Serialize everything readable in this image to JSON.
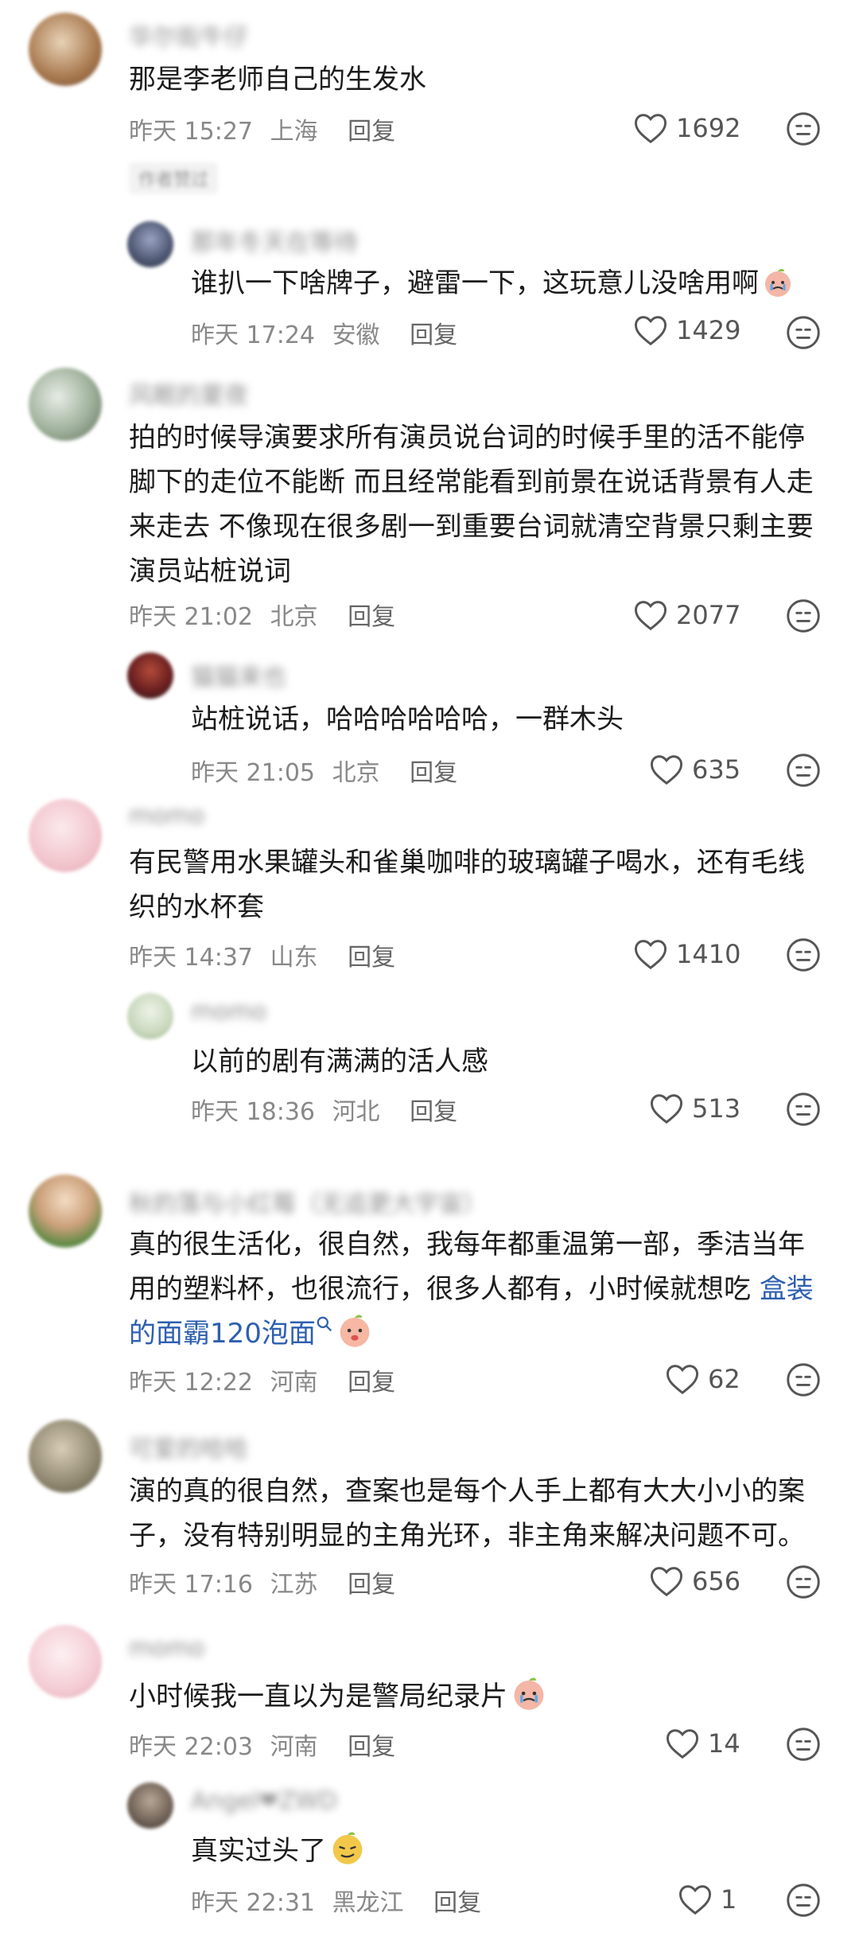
{
  "comments": [
    {
      "user": "华尔街牛仔",
      "text": "那是李老师自己的生发水",
      "date": "昨天",
      "time": "15:27",
      "location": "上海",
      "reply_label": "回复",
      "likes": "1692",
      "tag": "作者赞过"
    },
    {
      "user": "那年冬天在等待",
      "text": "谁扒一下啥牌子，避雷一下，这玩意儿没啥用啊",
      "date": "昨天",
      "time": "17:24",
      "location": "安徽",
      "reply_label": "回复",
      "likes": "1429"
    },
    {
      "user": "风眠的夏夜",
      "text": "拍的时候导演要求所有演员说台词的时候手里的活不能停脚下的走位不能断 而且经常能看到前景在说话背景有人走来走去 不像现在很多剧一到重要台词就清空背景只剩主要演员站桩说词",
      "date": "昨天",
      "time": "21:02",
      "location": "北京",
      "reply_label": "回复",
      "likes": "2077"
    },
    {
      "user": "猫猫来也",
      "text": "站桩说话，哈哈哈哈哈哈，一群木头",
      "date": "昨天",
      "time": "21:05",
      "location": "北京",
      "reply_label": "回复",
      "likes": "635"
    },
    {
      "user": "momo",
      "text": "有民警用水果罐头和雀巢咖啡的玻璃罐子喝水，还有毛线织的水杯套",
      "date": "昨天",
      "time": "14:37",
      "location": "山东",
      "reply_label": "回复",
      "likes": "1410"
    },
    {
      "user": "momo",
      "text": "以前的剧有满满的活人感",
      "date": "昨天",
      "time": "18:36",
      "location": "河北",
      "reply_label": "回复",
      "likes": "513"
    },
    {
      "user": "秋的落与小红莓（无追更大宇宙）",
      "text_before": "真的很生活化，很自然，我每年都重温第一部，季洁当年用的塑料杯，也很流行，很多人都有，小时候就想吃",
      "text_link": "盒装的面霸120泡面",
      "date": "昨天",
      "time": "12:22",
      "location": "河南",
      "reply_label": "回复",
      "likes": "62"
    },
    {
      "user": "可爱的哈哈",
      "text": "演的真的很自然，查案也是每个人手上都有大大小小的案子，没有特别明显的主角光环，非主角来解决问题不可。",
      "date": "昨天",
      "time": "17:16",
      "location": "江苏",
      "reply_label": "回复",
      "likes": "656"
    },
    {
      "user": "momo",
      "text": "小时候我一直以为是警局纪录片",
      "date": "昨天",
      "time": "22:03",
      "location": "河南",
      "reply_label": "回复",
      "likes": "14"
    },
    {
      "user": "Angel❤ZWD",
      "text": "真实过头了",
      "date": "昨天",
      "time": "22:31",
      "location": "黑龙江",
      "reply_label": "回复",
      "likes": "1"
    }
  ],
  "icons": {
    "like": "heart-outline-icon",
    "dislike": "meh-face-icon",
    "search": "search-icon"
  },
  "colors": {
    "text": "#1c1c1c",
    "meta": "#888888",
    "link": "#2d5fb0"
  }
}
